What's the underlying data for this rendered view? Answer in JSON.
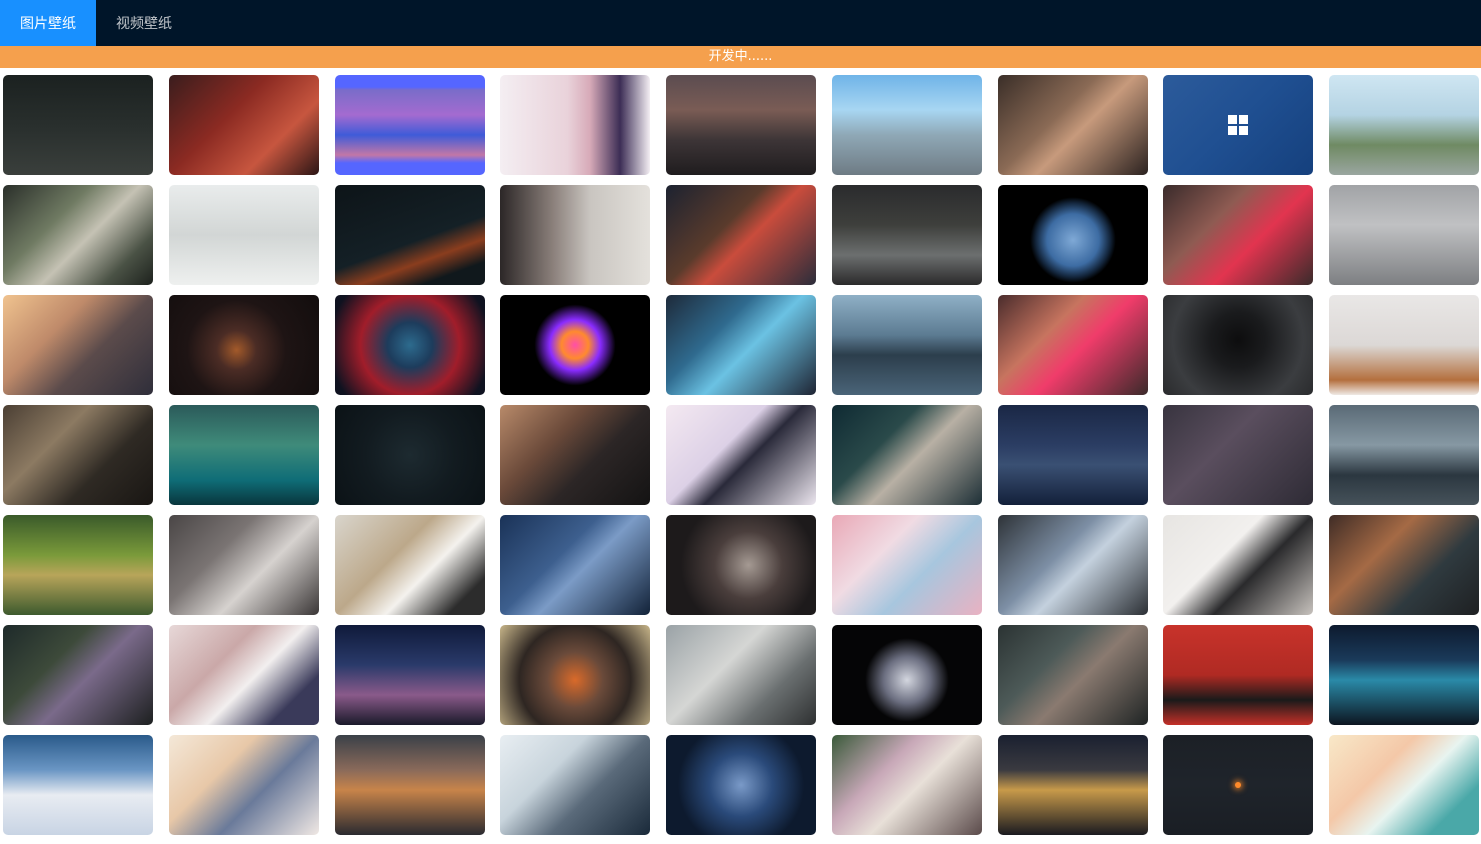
{
  "nav": {
    "tabs": [
      {
        "label": "图片壁纸",
        "active": true
      },
      {
        "label": "视频壁纸",
        "active": false
      }
    ],
    "accent_color": "#1890ff",
    "bar_color": "#001529"
  },
  "notice": {
    "text": "开发中......",
    "color": "#f5a04d"
  },
  "wallpapers": [
    {
      "bg": "linear-gradient(180deg,#1b2120 0%,#2a302e 55%,#3a3f3c 100%)"
    },
    {
      "bg": "linear-gradient(135deg,#3a1d1d 0%,#8b2a22 40%,#c7563f 70%,#2b1515 100%)"
    },
    {
      "bg": "linear-gradient(180deg,#5566ff 0%,#5566ff 12%,#7a6cc9 15%,#a46bd0 40%,#3f5bd8 60%,#c277a7 80%,#5566ff 88%,#5566ff 100%)"
    },
    {
      "bg": "linear-gradient(90deg,#f4eef2 0%,#e9d2da 45%,#d7aab8 60%,#3c2d55 80%,#f3eef3 100%)"
    },
    {
      "bg": "linear-gradient(180deg,#5b4c50 0%,#7a5c55 35%,#3d3537 65%,#1f1c1e 100%)"
    },
    {
      "bg": "linear-gradient(180deg,#6fb4e8 0%,#a8d6f2 35%,#8fa8b6 60%,#6e7b84 100%)"
    },
    {
      "bg": "linear-gradient(135deg,#3a2e28 0%,#8a6a55 40%,#c79a7c 55%,#2b2220 100%)"
    },
    {
      "bg": "linear-gradient(135deg,#2c5b9b 0%,#1f4f91 50%,#15407d 100%)",
      "icon": "windows-logo"
    },
    {
      "bg": "linear-gradient(180deg,#cfe6f2 0%,#b4d3e3 40%,#6f8a63 70%,#9aa6a0 100%)"
    },
    {
      "bg": "linear-gradient(135deg,#2a2f2a 0%,#6f7a62 35%,#c5c2b4 55%,#4a5245 80%,#1d211d 100%)"
    },
    {
      "bg": "linear-gradient(180deg,#e9ecec 0%,#d2d6d5 50%,#eef0ef 100%)"
    },
    {
      "bg": "linear-gradient(160deg,#0d1418 0%,#142026 55%,#8a3d1e 70%,#10181c 85%)"
    },
    {
      "bg": "linear-gradient(90deg,#2c2727 0%,#8a7f7a 35%,#c9c5c0 60%,#e4e1dc 100%)"
    },
    {
      "bg": "linear-gradient(135deg,#1c2230 0%,#5a3b2c 40%,#c94c3c 55%,#2b2d3b 100%)"
    },
    {
      "bg": "linear-gradient(180deg,#2a2b2d 0%,#3e3f3c 40%,#6c6f6f 70%,#2b2a2b 100%)"
    },
    {
      "bg": "radial-gradient(circle at 50% 55%,#7fa9d6 0%,#3d6ca3 28%,#13253b 40%,#000000 46%)"
    },
    {
      "bg": "linear-gradient(135deg,#3a2b2b 0%,#8e5b52 35%,#e2344f 60%,#3a2b2b 100%)"
    },
    {
      "bg": "linear-gradient(180deg,#a1a3a6 0%,#c0c1c3 40%,#7d7f82 100%)"
    },
    {
      "bg": "linear-gradient(135deg,#f0c38f 0%,#bf8a6a 35%,#5b4b4b 60%,#2f2e3a 100%)"
    },
    {
      "bg": "radial-gradient(circle at 45% 55%,#a35a2a 0%,#4b2c25 20%,#1e1414 50%,#120d0d 100%)"
    },
    {
      "bg": "radial-gradient(circle at 50% 50%,#2d6b8e 0%,#1d3c5c 25%,#a11d2a 55%,#0f1220 90%)"
    },
    {
      "bg": "radial-gradient(circle at 50% 50%,#ff4fa8 0%,#ff8a2e 15%,#8a2cff 28%,#000000 45%)"
    },
    {
      "bg": "linear-gradient(135deg,#1e2a3a 0%,#2f6a8e 35%,#6bc2e3 55%,#1e2433 100%)"
    },
    {
      "bg": "linear-gradient(180deg,#8fb0c6 0%,#5c7b92 40%,#2c3e4c 60%,#4a6478 100%)"
    },
    {
      "bg": "linear-gradient(135deg,#4a2c2c 0%,#c7745f 35%,#f03c6a 55%,#3a2a2a 100%)"
    },
    {
      "bg": "radial-gradient(circle at 50% 45%,#0d0d0e 0%,#1a1b1d 30%,#3b3d40 70%,#2a2b2d 100%)"
    },
    {
      "bg": "linear-gradient(180deg,#e9e7e6 0%,#dcd8d6 50%,#b46f3e 85%,#efe9e5 100%)"
    },
    {
      "bg": "linear-gradient(135deg,#4b3f34 0%,#8c7a62 35%,#2f2a24 65%,#191613 100%)"
    },
    {
      "bg": "linear-gradient(180deg,#2b5a5a 0%,#3f8b7a 40%,#0f6d77 75%,#09363d 100%)"
    },
    {
      "bg": "radial-gradient(circle at 50% 50%,#1d2a30 0%,#121b20 50%,#0b1216 100%)"
    },
    {
      "bg": "linear-gradient(135deg,#b88a6a 0%,#6b4a3a 35%,#2c2626 60%,#141313 100%)"
    },
    {
      "bg": "linear-gradient(135deg,#f4e9f1 0%,#dcd0e6 40%,#2a2a3a 55%,#ece6ef 100%)"
    },
    {
      "bg": "linear-gradient(135deg,#0f2a33 0%,#2a4a4a 35%,#b8b0a4 55%,#1d2f36 100%)"
    },
    {
      "bg": "linear-gradient(180deg,#1a2745 0%,#2b3d63 40%,#3a5073 60%,#13203a 100%)"
    },
    {
      "bg": "linear-gradient(135deg,#38343f 0%,#5a4e5e 40%,#2e2b35 100%)"
    },
    {
      "bg": "linear-gradient(180deg,#5a6a76 0%,#8698a3 40%,#2b3740 70%,#46525a 100%)"
    },
    {
      "bg": "linear-gradient(180deg,#3a5a2a 0%,#7a9a3a 40%,#b8a55a 60%,#3d5a2e 100%)"
    },
    {
      "bg": "linear-gradient(135deg,#4a4646 0%,#7a7473 35%,#d6d2cf 60%,#3a3636 100%)"
    },
    {
      "bg": "linear-gradient(135deg,#d9d5cc 0%,#bca88a 40%,#f4f2ee 60%,#2c2c2c 85%)"
    },
    {
      "bg": "linear-gradient(135deg,#1a3257 0%,#3d5f8e 40%,#7b9bc6 55%,#122238 100%)"
    },
    {
      "bg": "radial-gradient(circle at 55% 50%,#a59a93 0%,#4a3e3c 35%,#1d1a1b 70%)"
    },
    {
      "bg": "linear-gradient(135deg,#e9a8b6 0%,#f0dbe3 35%,#a7c6de 60%,#e9b2c2 100%)"
    },
    {
      "bg": "linear-gradient(135deg,#2e3338 0%,#7d8fa5 40%,#c4d1de 55%,#2b2f34 100%)"
    },
    {
      "bg": "linear-gradient(135deg,#e7e5e2 0%,#f2f0ee 40%,#2a2a2c 60%,#c7c2bd 100%)"
    },
    {
      "bg": "linear-gradient(135deg,#3f2c26 0%,#a56a45 35%,#2f3a3f 65%,#1e2022 100%)"
    },
    {
      "bg": "linear-gradient(135deg,#1e2a2a 0%,#3d4a3a 35%,#7a6a8a 55%,#1d2020 100%)"
    },
    {
      "bg": "linear-gradient(135deg,#e7d8d8 0%,#caa8a8 35%,#f2efef 55%,#3a3a5a 80%)"
    },
    {
      "bg": "linear-gradient(180deg,#0f1a3a 0%,#2a3a6a 40%,#8a5a8a 70%,#1a1a2a 100%)"
    },
    {
      "bg": "radial-gradient(circle at 50% 55%,#d96a2a 0%,#6a4a3a 30%,#2e2622 60%,#c8b68a 100%)"
    },
    {
      "bg": "linear-gradient(135deg,#9aa2a6 0%,#d5d6d4 40%,#6a6f70 70%,#2e3031 100%)"
    },
    {
      "bg": "radial-gradient(circle at 50% 55%,#d3d6df 0%,#6b6e80 25%,#050506 45%)"
    },
    {
      "bg": "linear-gradient(135deg,#2b3333 0%,#4d5a58 35%,#8a7a70 55%,#1f2424 100%)"
    },
    {
      "bg": "linear-gradient(180deg,#c8332b 0%,#b02a23 50%,#1a1a1a 75%,#c43028 100%)"
    },
    {
      "bg": "linear-gradient(180deg,#0d1a2e 0%,#1a3a5a 35%,#2a8aa8 55%,#0d1520 100%)"
    },
    {
      "bg": "linear-gradient(180deg,#2a5a8a 0%,#6a96c4 35%,#e8ecf2 60%,#c8d4e4 100%)"
    },
    {
      "bg": "linear-gradient(135deg,#f4e8d8 0%,#e8c8a8 35%,#6a7a9a 60%,#f0e8e4 100%)"
    },
    {
      "bg": "linear-gradient(180deg,#3a4048 0%,#8a6a5a 35%,#c8844a 55%,#2a2a30 100%)"
    },
    {
      "bg": "linear-gradient(135deg,#e8eef2 0%,#c8d4dc 35%,#5a6a7a 60%,#1a2a3a 100%)"
    },
    {
      "bg": "radial-gradient(circle at 50% 50%,#7a9ac8 0%,#2a4a7a 35%,#0d1a2e 70%)"
    },
    {
      "bg": "linear-gradient(135deg,#3a5a3a 0%,#c8a8b8 35%,#e8e0d8 55%,#5a4a4a 100%)"
    },
    {
      "bg": "linear-gradient(180deg,#1a2030 0%,#3a3a40 35%,#c89a4a 55%,#1a1a20 100%)"
    },
    {
      "bg": "linear-gradient(180deg,#1c2026 0%,#1f242b 50%,#1a1e24 100%)",
      "icon": "glow-dot"
    },
    {
      "bg": "linear-gradient(135deg,#f8e8c8 0%,#f4c8a8 35%,#e8f4f0 55%,#4aa8a8 80%)"
    }
  ]
}
